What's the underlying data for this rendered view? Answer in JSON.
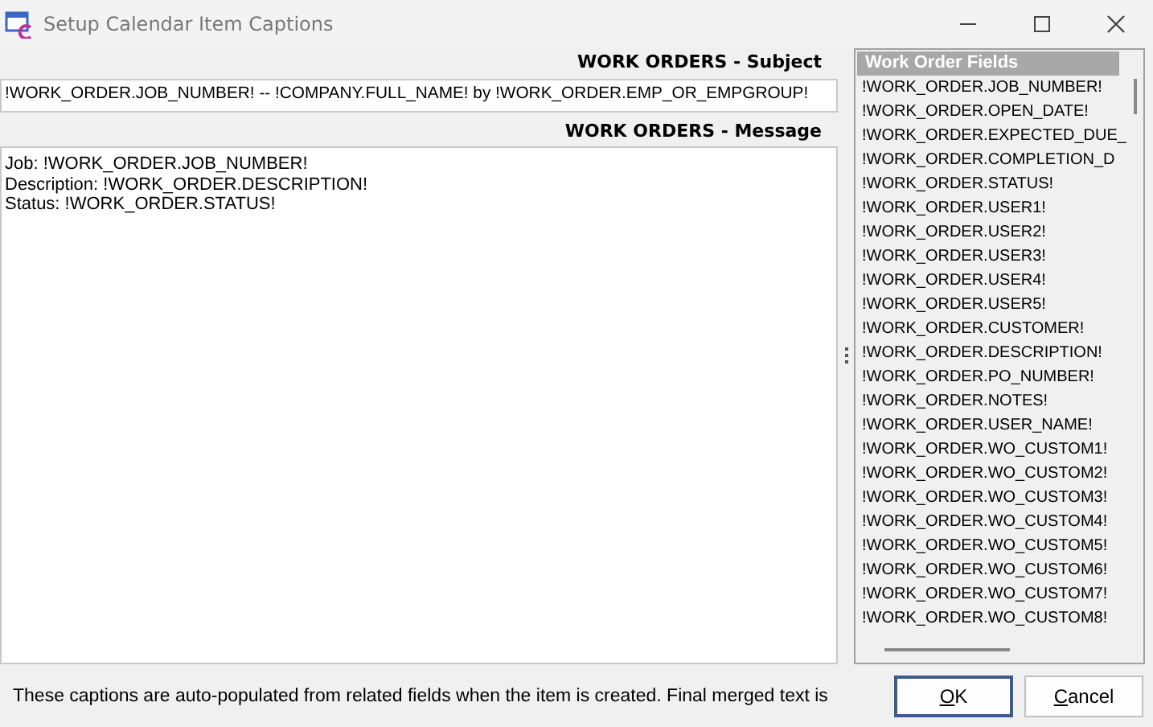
{
  "window": {
    "title": "Setup Calendar Item Captions"
  },
  "subject": {
    "label": "WORK ORDERS - Subject",
    "value": "!WORK_ORDER.JOB_NUMBER! -- !COMPANY.FULL_NAME! by !WORK_ORDER.EMP_OR_EMPGROUP!"
  },
  "message": {
    "label": "WORK ORDERS - Message",
    "lines": [
      "Job:  !WORK_ORDER.JOB_NUMBER!",
      "Description:  !WORK_ORDER.DESCRIPTION!",
      "Status:  !WORK_ORDER.STATUS!"
    ]
  },
  "fields": {
    "header": "Work Order Fields",
    "items": [
      "!WORK_ORDER.JOB_NUMBER!",
      "!WORK_ORDER.OPEN_DATE!",
      "!WORK_ORDER.EXPECTED_DUE_",
      "!WORK_ORDER.COMPLETION_D",
      "!WORK_ORDER.STATUS!",
      "!WORK_ORDER.USER1!",
      "!WORK_ORDER.USER2!",
      "!WORK_ORDER.USER3!",
      "!WORK_ORDER.USER4!",
      "!WORK_ORDER.USER5!",
      "!WORK_ORDER.CUSTOMER!",
      "!WORK_ORDER.DESCRIPTION!",
      "!WORK_ORDER.PO_NUMBER!",
      "!WORK_ORDER.NOTES!",
      "!WORK_ORDER.USER_NAME!",
      "!WORK_ORDER.WO_CUSTOM1!",
      "!WORK_ORDER.WO_CUSTOM2!",
      "!WORK_ORDER.WO_CUSTOM3!",
      "!WORK_ORDER.WO_CUSTOM4!",
      "!WORK_ORDER.WO_CUSTOM5!",
      "!WORK_ORDER.WO_CUSTOM6!",
      "!WORK_ORDER.WO_CUSTOM7!",
      "!WORK_ORDER.WO_CUSTOM8!"
    ]
  },
  "footer": {
    "note": "These captions are auto-populated from related fields when the item is created.  Final merged text is"
  },
  "buttons": [
    {
      "label": "OK",
      "default": true
    },
    {
      "label": "Cancel",
      "default": false
    }
  ]
}
